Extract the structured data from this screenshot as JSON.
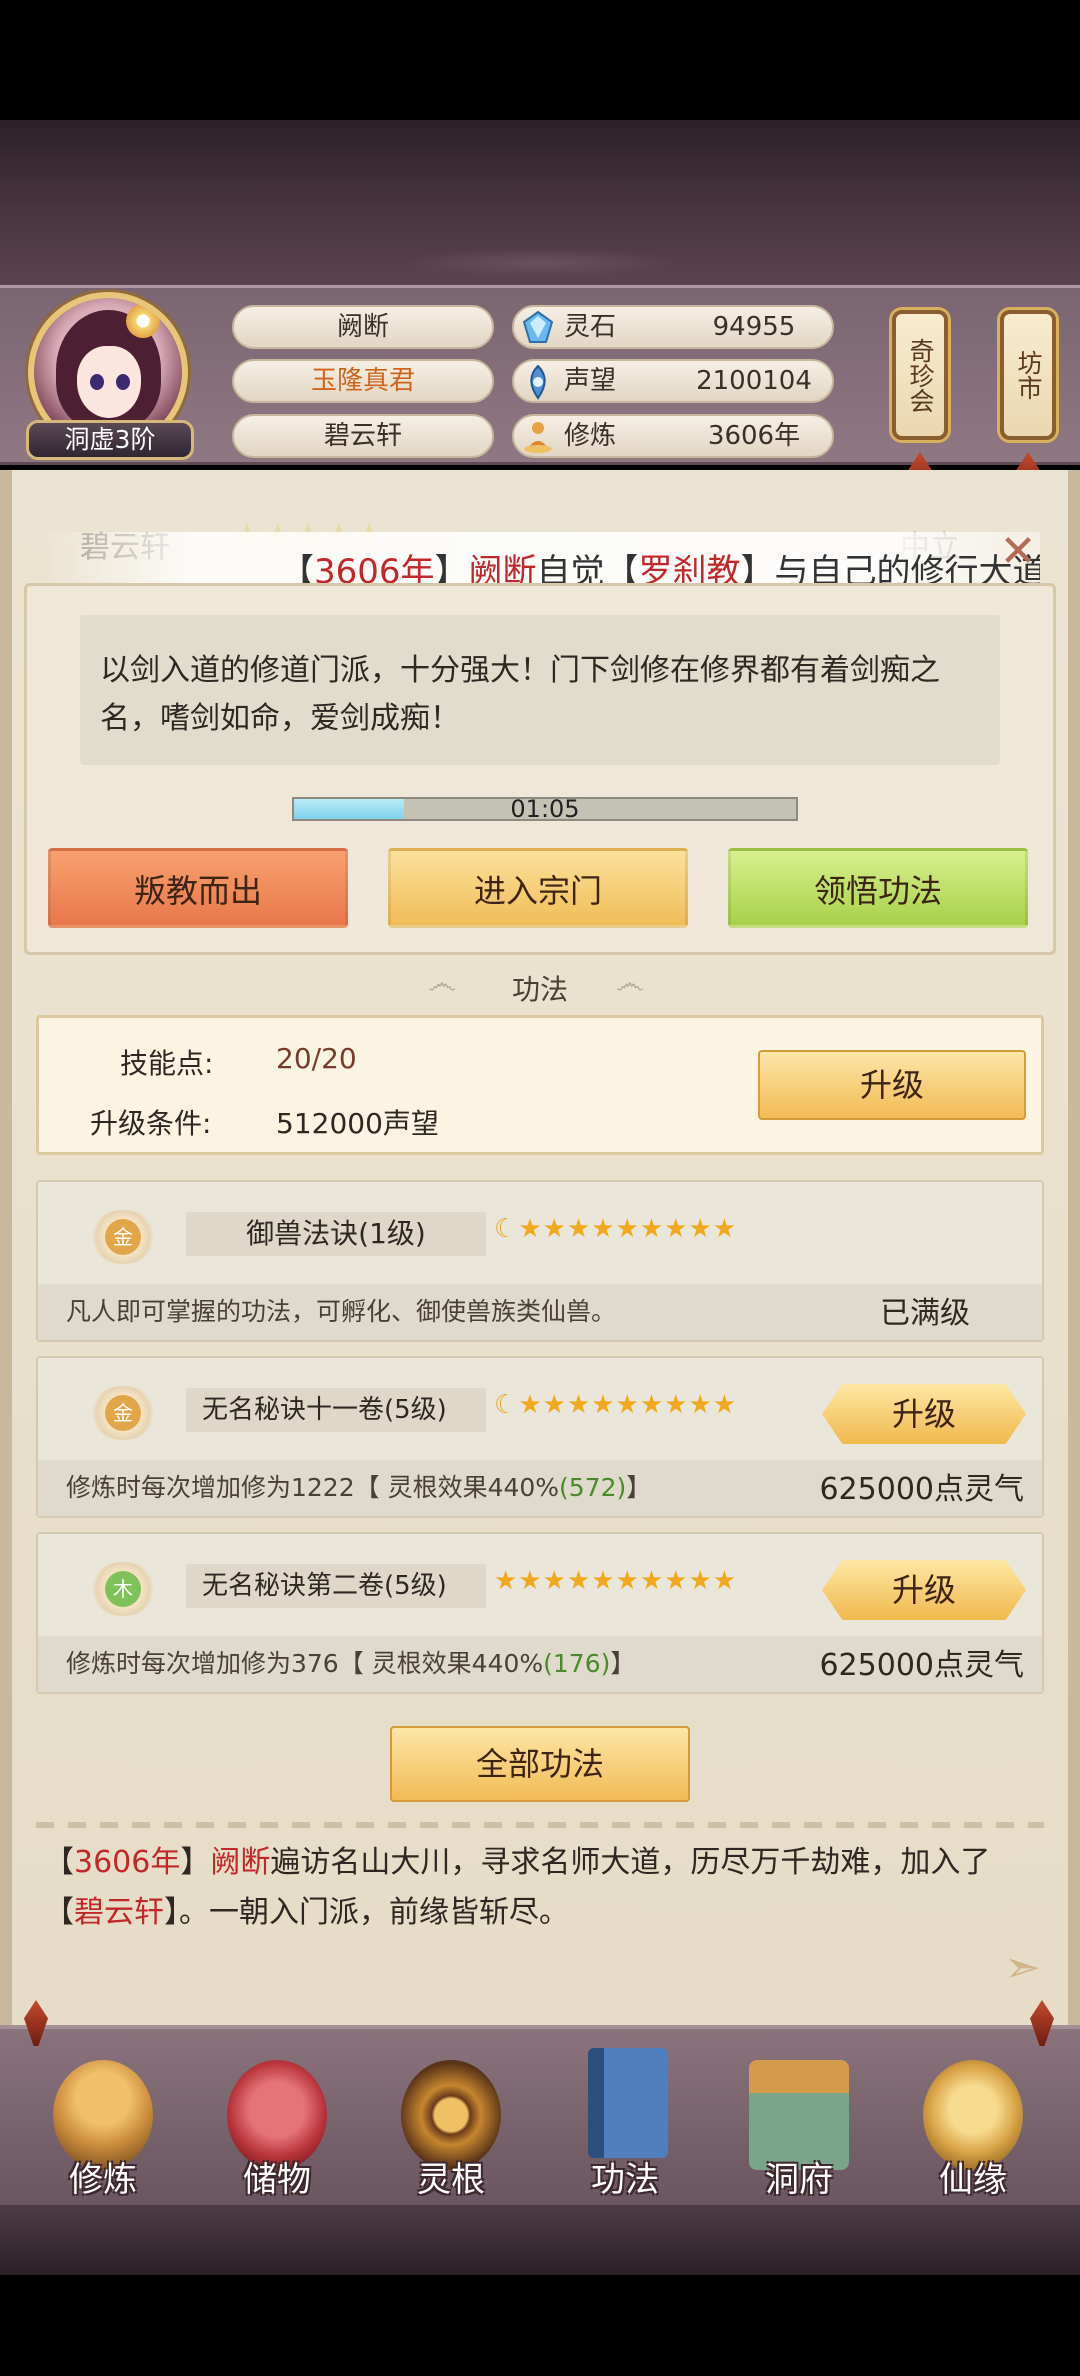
{
  "header": {
    "rank": "洞虚3阶",
    "name": "阙断",
    "title": "玉隆真君",
    "sect": "碧云轩",
    "stats": [
      {
        "icon": "spirit-stone-icon",
        "label": "灵石",
        "value": "94955"
      },
      {
        "icon": "reputation-icon",
        "label": "声望",
        "value": "2100104"
      },
      {
        "icon": "cultivation-icon",
        "label": "修炼",
        "value": "3606年"
      }
    ],
    "lanterns": [
      "奇珍会",
      "坊市"
    ]
  },
  "background": {
    "ghost_sect_name": "碧云轩",
    "ghost_right_text": "中立"
  },
  "banner": {
    "bracket_open": "【",
    "year": "3606年",
    "bracket_close": "】",
    "actor": "阙断",
    "verb": "自觉",
    "sect_open": "【",
    "sect": "罗刹教",
    "sect_close": "】",
    "tail": "与自己的修行大道"
  },
  "popup": {
    "description": "以剑入道的修道门派，十分强大！门下剑修在修界都有着剑痴之名，嗜剑如命，爱剑成痴！",
    "timer": "01:05",
    "timer_progress": 0.22,
    "buttons": {
      "betray": "叛教而出",
      "enter": "进入宗门",
      "learn": "领悟功法"
    }
  },
  "skills": {
    "section_title": "功法",
    "points_label": "技能点:",
    "points_value": "20/20",
    "condition_label": "升级条件:",
    "condition_value": "512000声望",
    "upgrade_label": "升级"
  },
  "techniques": [
    {
      "element": "金",
      "element_color": "#e2a64a",
      "name": "御兽法诀(1级)",
      "stars": "★★★★★★★★★",
      "has_moon": true,
      "desc_prefix": "凡人即可掌握的功法，可孵化、御使兽族类仙兽。",
      "status": "已满级"
    },
    {
      "element": "金",
      "element_color": "#e2a64a",
      "name": "无名秘诀十一卷(5级)",
      "stars": "★★★★★★★★★",
      "has_moon": true,
      "desc_prefix": "修炼时每次增加修为1222【 灵根效果440%",
      "desc_green": "(572)",
      "desc_suffix": "】",
      "cost": "625000点灵气",
      "button": "升级"
    },
    {
      "element": "木",
      "element_color": "#7fc25a",
      "name": "无名秘诀第二卷(5级)",
      "stars": "★★★★★★★★★★",
      "has_moon": false,
      "desc_prefix": "修炼时每次增加修为376【 灵根效果440%",
      "desc_green": "(176)",
      "desc_suffix": "】",
      "cost": "625000点灵气",
      "button": "升级"
    }
  ],
  "all_techniques_label": "全部功法",
  "story": {
    "p1": "【",
    "year": "3606年",
    "p2": "】",
    "actor": "阙断",
    "p3": "遍访名山大川，寻求名师大道，历尽万千劫难，加入了",
    "p4": "【",
    "sect": "碧云轩",
    "p5": "】。一朝入门派，前缘皆斩尽。"
  },
  "nav": [
    {
      "label": "修炼",
      "icon": "cultivate-monk-icon",
      "color": "#c98b3c"
    },
    {
      "label": "储物",
      "icon": "storage-bag-icon",
      "color": "#b8343a"
    },
    {
      "label": "灵根",
      "icon": "spirit-root-icon",
      "color": "#c6862f"
    },
    {
      "label": "功法",
      "icon": "skill-book-icon",
      "color": "#3f6fa8"
    },
    {
      "label": "洞府",
      "icon": "cave-house-icon",
      "color": "#5b8a6a"
    },
    {
      "label": "仙缘",
      "icon": "immortal-fate-icon",
      "color": "#d9a447"
    }
  ]
}
